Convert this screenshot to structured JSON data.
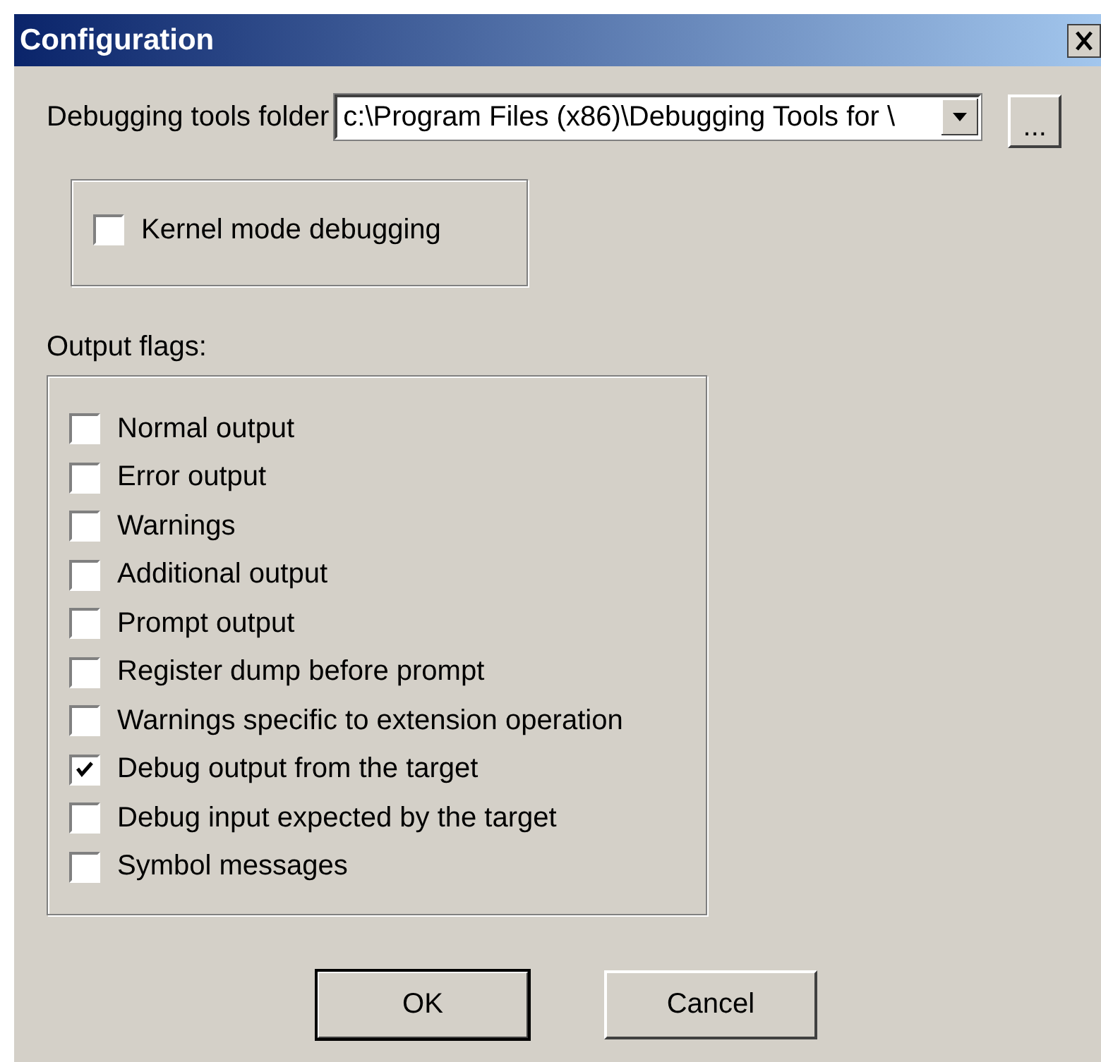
{
  "window": {
    "title": "Configuration"
  },
  "folder": {
    "label": "Debugging tools folder",
    "value": "c:\\Program Files (x86)\\Debugging Tools for \\",
    "browse": "..."
  },
  "kernel": {
    "label": "Kernel mode debugging",
    "checked": false
  },
  "output_flags": {
    "label": "Output flags:",
    "items": [
      {
        "label": "Normal output",
        "checked": false
      },
      {
        "label": "Error output",
        "checked": false
      },
      {
        "label": "Warnings",
        "checked": false
      },
      {
        "label": "Additional output",
        "checked": false
      },
      {
        "label": "Prompt output",
        "checked": false
      },
      {
        "label": "Register dump before prompt",
        "checked": false
      },
      {
        "label": "Warnings specific to extension operation",
        "checked": false
      },
      {
        "label": "Debug output from the target",
        "checked": true
      },
      {
        "label": "Debug input expected by the target",
        "checked": false
      },
      {
        "label": "Symbol messages",
        "checked": false
      }
    ]
  },
  "buttons": [
    {
      "label": "OK",
      "default": true
    },
    {
      "label": "Cancel",
      "default": false
    }
  ]
}
